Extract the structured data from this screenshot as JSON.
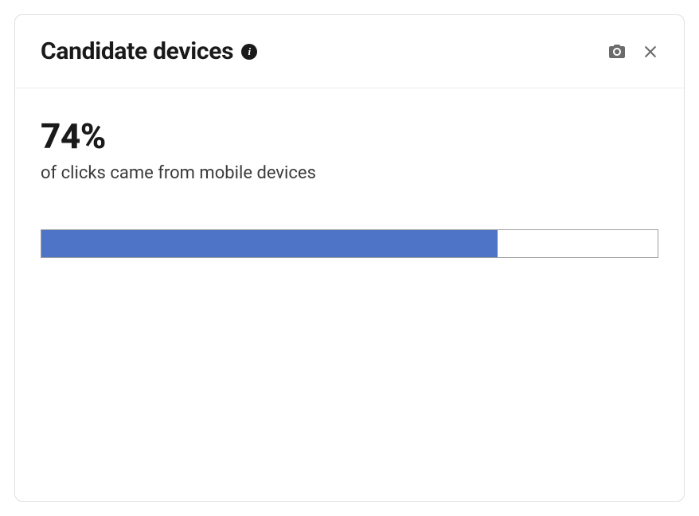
{
  "header": {
    "title": "Candidate devices"
  },
  "body": {
    "percent_label": "74%",
    "subtext": "of clicks came from mobile devices"
  },
  "chart_data": {
    "type": "bar",
    "title": "Candidate devices",
    "categories": [
      "mobile devices"
    ],
    "values": [
      74
    ],
    "ylim": [
      0,
      100
    ],
    "unit": "%",
    "xlabel": "",
    "ylabel": ""
  },
  "colors": {
    "bar_fill": "#4d74c6",
    "bar_border": "#9e9e9e"
  }
}
